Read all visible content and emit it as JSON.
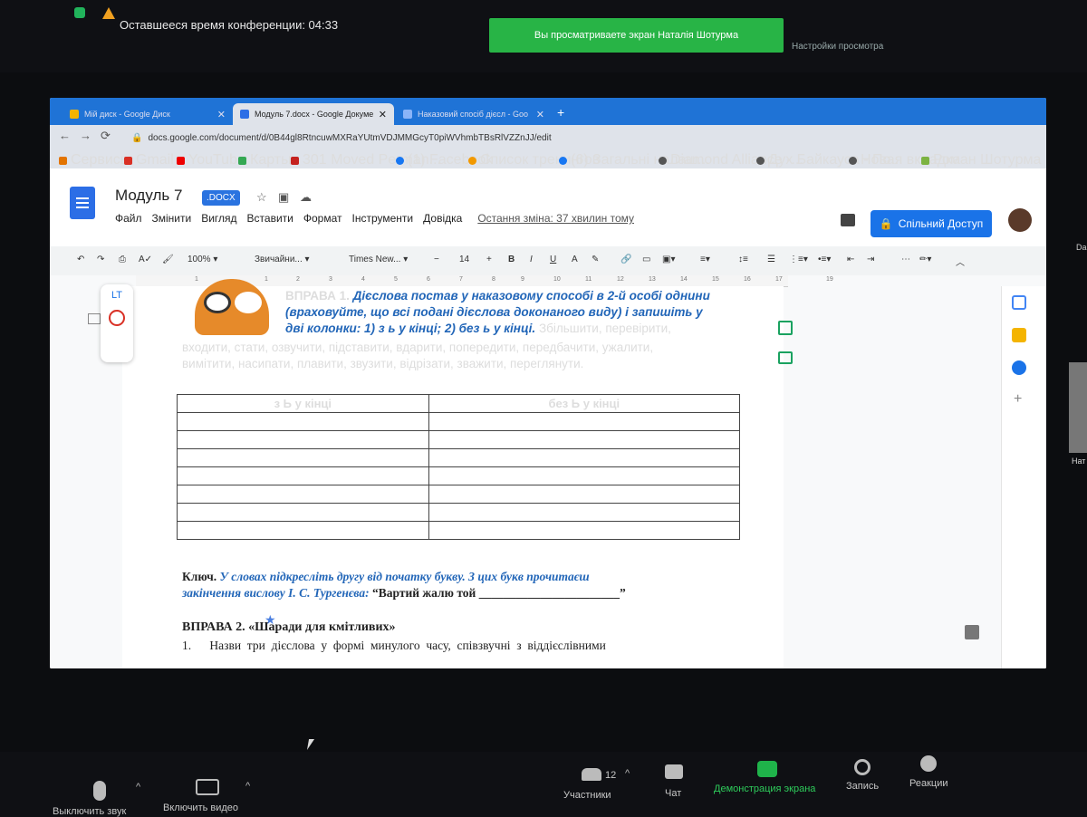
{
  "zoom": {
    "remaining_time": "Оставшееся время конференции: 04:33",
    "share_banner": "Вы просматриваете экран Наталія Шотурма",
    "view_settings": "Настройки просмотра",
    "participant_side_label": "Нат",
    "side_label_da": "Da",
    "bottom": {
      "mute": "Выключить звук",
      "video": "Включить видео",
      "participants_count": "12",
      "participants": "Участники",
      "chat": "Чат",
      "share_screen": "Демонстрация экрана",
      "record": "Запись",
      "reactions": "Реакции"
    }
  },
  "browser": {
    "tabs": [
      {
        "label": "Мій диск - Google Диск"
      },
      {
        "label": "Модуль 7.docx - Google Докуме"
      },
      {
        "label": "Наказовий спосіб дієсл - Goo"
      }
    ],
    "url": "docs.google.com/document/d/0B44gl8RtncuwMXRaYUtmVDJMMGcyT0piWVhmbTBsRlVZZnJJ/edit",
    "bookmarks": [
      "Сервисы",
      "Gmail",
      "YouTube",
      "Карты",
      "301 Moved Perman...",
      "(1) Facebook",
      "Список тренингов",
      "(6) Загальні налаш...",
      "Diamond Alliance -...",
      "Дух Байкауса - По...",
      "Новая вкладка",
      "Роман Шотурма"
    ]
  },
  "docs": {
    "title": "Модуль 7",
    "badge": ".DOCX",
    "menu": [
      "Файл",
      "Змінити",
      "Вигляд",
      "Вставити",
      "Формат",
      "Інструменти",
      "Довідка"
    ],
    "last_edit": "Остання зміна: 37 хвилин тому",
    "share_button": "Спільний Доступ",
    "toolbar": {
      "zoom": "100%",
      "style": "Звичайни...",
      "font": "Times New...",
      "size": "14"
    },
    "ruler": [
      "1",
      "1",
      "2",
      "3",
      "4",
      "5",
      "6",
      "7",
      "8",
      "9",
      "10",
      "11",
      "12",
      "13",
      "14",
      "15",
      "16",
      "17",
      "19"
    ]
  },
  "document": {
    "ex1_title": "ВПРАВА 1.",
    "ex1_instr_1": "Дієслова постав у наказовому способі в 2-й особі однини",
    "ex1_instr_2": "(враховуйте, що всі подані дієслова доконаного виду) і запишіть у",
    "ex1_instr_3": "дві колонки: 1) з ь у кінці; 2) без ь у кінці.",
    "ex1_words_1": "Збільшити, перевірити,",
    "ex1_words_2": "входити, стати, озвучити, підставити, вдарити, попередити, передбачити, ужалити,",
    "ex1_words_3": "вимітити, насипати, плавити, звузити, відрізати, зважити, переглянути.",
    "table_headers": [
      "з Ь у кінці",
      "без Ь у кінці"
    ],
    "key_label": "Ключ.",
    "key_text_1": "У словах підкресліть другу від початку букву. З цих букв прочитаєш",
    "key_text_2": "закінчення вислову І. С. Тургенєва:",
    "key_quote": "“Вартий жалю той",
    "key_blank": "_______________________”",
    "ex2_title": "ВПРАВА 2. «Шаради для кмітливих»",
    "ex2_line": "1.      Назви  три  дієслова  у  формі  минулого  часу,  співзвучні  з  віддієслівними"
  }
}
